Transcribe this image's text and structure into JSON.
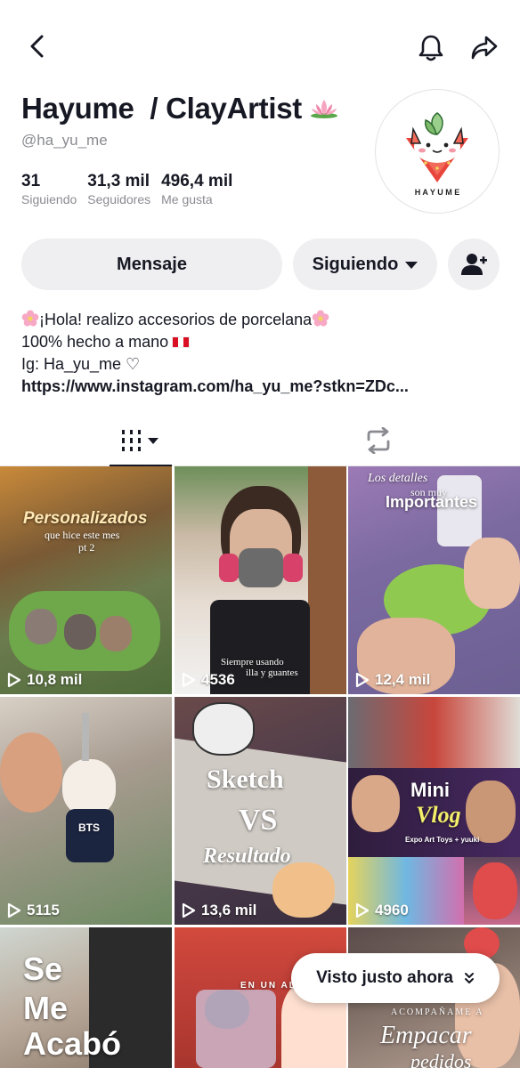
{
  "header": {
    "back_icon": "chevron-left-icon",
    "bell_icon": "bell-icon",
    "share_icon": "share-arrow-icon"
  },
  "profile": {
    "name": "Hayume  / ClayArtist",
    "name_emoji": "lotus-icon",
    "handle": "@ha_yu_me",
    "avatar_text": "H A Y U M E",
    "stats": [
      {
        "value": "31",
        "label": "Siguiendo"
      },
      {
        "value": "31,3 mil",
        "label": "Seguidores"
      },
      {
        "value": "496,4 mil",
        "label": "Me gusta"
      }
    ]
  },
  "actions": {
    "message_label": "Mensaje",
    "following_label": "Siguiendo",
    "add_friend_icon": "add-user-icon"
  },
  "bio": {
    "line1": "¡Hola! realizo accesorios de porcelana",
    "line2": "100% hecho a mano",
    "line3": "Ig: Ha_yu_me ♡",
    "link": "https://www.instagram.com/ha_yu_me?stkn=ZDc..."
  },
  "tabs": {
    "videos_icon": "grid-videos-icon",
    "repost_icon": "repost-icon"
  },
  "videos": [
    {
      "views": "10,8 mil",
      "overlay_title": "Personalizados",
      "overlay_sub": "que hice este mes",
      "overlay_sub2": "pt 2"
    },
    {
      "views": "4536",
      "overlay_sub": "Siempre usando",
      "overlay_sub2": "illa y guantes"
    },
    {
      "views": "12,4 mil",
      "overlay_sub": "Los detalles",
      "overlay_sub2": "son muy",
      "overlay_title": "Importantes"
    },
    {
      "views": "5115",
      "overlay_title": "BTS"
    },
    {
      "views": "13,6 mil",
      "overlay_title": "Sketch",
      "overlay_sub": "VS",
      "overlay_sub2": "Resultado"
    },
    {
      "views": "4960",
      "overlay_title": "Mini",
      "overlay_sub": "Vlog",
      "overlay_sub2": "Expo Art Toys + yuuki"
    },
    {
      "overlay_title": "Se",
      "overlay_sub": "Me",
      "overlay_sub2": "Acabó"
    },
    {
      "overlay_sub": "EN UN AL"
    },
    {
      "overlay_sub": "ACOMPAÑAME A",
      "overlay_title": "Empacar",
      "overlay_sub2": "pedidos"
    }
  ],
  "toast": {
    "label": "Visto justo ahora"
  }
}
